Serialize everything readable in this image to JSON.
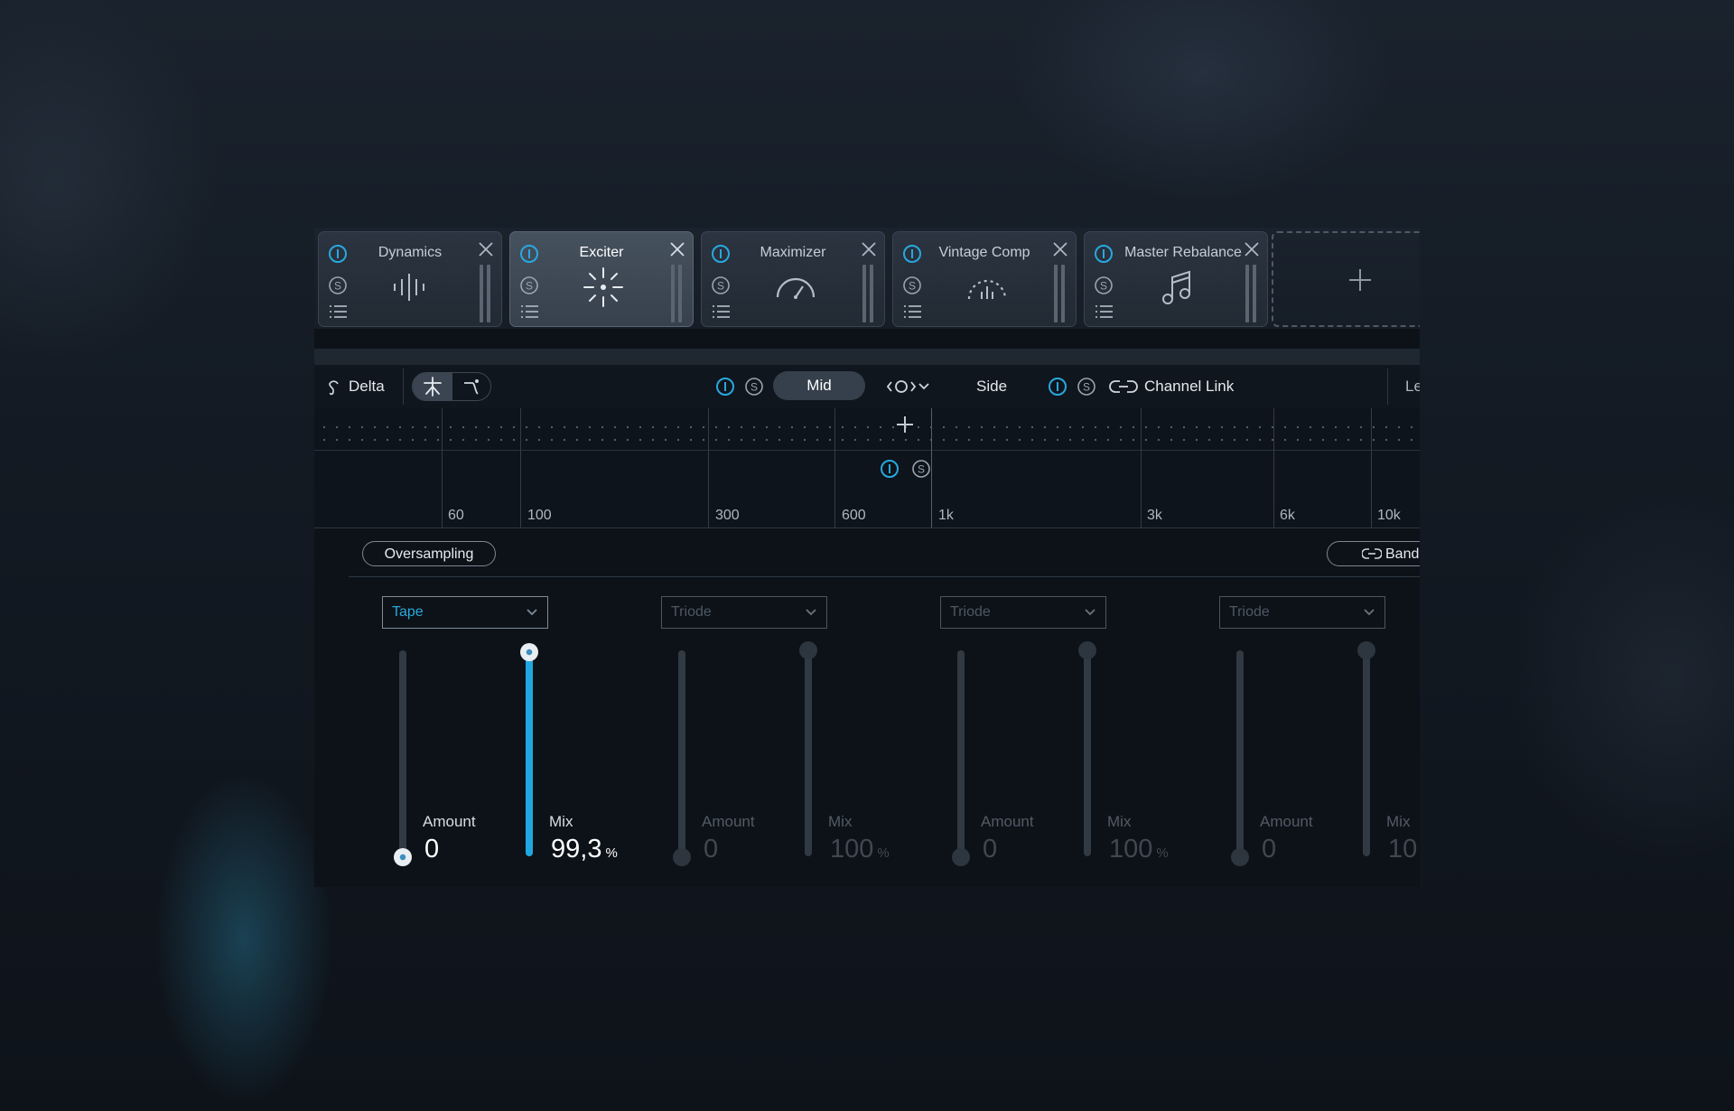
{
  "modules": [
    {
      "name": "Dynamics",
      "active": false
    },
    {
      "name": "Exciter",
      "active": true
    },
    {
      "name": "Maximizer",
      "active": false
    },
    {
      "name": "Vintage Comp",
      "active": false
    },
    {
      "name": "Master Rebalance",
      "active": false
    }
  ],
  "controls": {
    "delta_label": "Delta",
    "mid_label": "Mid",
    "side_label": "Side",
    "channel_link_label": "Channel Link",
    "right_cut_label": "Le"
  },
  "frequency_labels": [
    "60",
    "100",
    "300",
    "600",
    "1k",
    "3k",
    "6k",
    "10k"
  ],
  "band_bar": {
    "oversampling_label": "Oversampling",
    "band_link_label": "Band"
  },
  "bands": [
    {
      "mode": "Tape",
      "amount_label": "Amount",
      "amount_value": "0",
      "mix_label": "Mix",
      "mix_value": "99,3",
      "mix_unit": "%",
      "mix_level": 0.993,
      "enabled": true
    },
    {
      "mode": "Triode",
      "amount_label": "Amount",
      "amount_value": "0",
      "mix_label": "Mix",
      "mix_value": "100",
      "mix_unit": "%",
      "mix_level": 1.0,
      "enabled": false
    },
    {
      "mode": "Triode",
      "amount_label": "Amount",
      "amount_value": "0",
      "mix_label": "Mix",
      "mix_value": "100",
      "mix_unit": "%",
      "mix_level": 1.0,
      "enabled": false
    },
    {
      "mode": "Triode",
      "amount_label": "Amount",
      "amount_value": "0",
      "mix_label": "Mix",
      "mix_value": "10",
      "mix_unit": "",
      "mix_level": 1.0,
      "enabled": false
    }
  ],
  "colors": {
    "accent": "#1fa8e0",
    "panel": "#0d1218",
    "module_active": "#46515e"
  }
}
